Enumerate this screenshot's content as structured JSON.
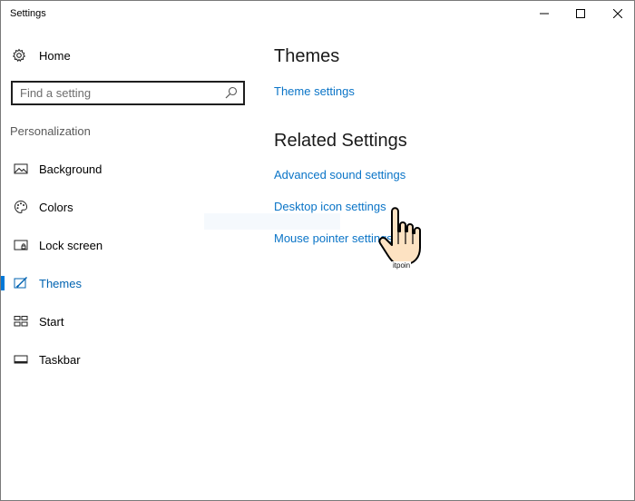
{
  "window": {
    "title": "Settings",
    "controls": {
      "minimize": "minimize-icon",
      "maximize": "maximize-icon",
      "close": "close-icon"
    }
  },
  "sidebar": {
    "home_label": "Home",
    "search_placeholder": "Find a setting",
    "section_title": "Personalization",
    "items": [
      {
        "label": "Background",
        "icon": "picture-icon",
        "selected": false
      },
      {
        "label": "Colors",
        "icon": "palette-icon",
        "selected": false
      },
      {
        "label": "Lock screen",
        "icon": "lock-screen-icon",
        "selected": false
      },
      {
        "label": "Themes",
        "icon": "brush-icon",
        "selected": true
      },
      {
        "label": "Start",
        "icon": "start-icon",
        "selected": false
      },
      {
        "label": "Taskbar",
        "icon": "taskbar-icon",
        "selected": false
      }
    ]
  },
  "main": {
    "themes_heading": "Themes",
    "theme_settings_link": "Theme settings",
    "related_heading": "Related Settings",
    "related_links": [
      "Advanced sound settings",
      "Desktop icon settings",
      "Mouse pointer settings"
    ]
  },
  "overlay": {
    "watermark": "itpoin"
  },
  "colors": {
    "accent": "#0078d7",
    "link": "#0a74c7",
    "selected_text": "#0063b1"
  }
}
